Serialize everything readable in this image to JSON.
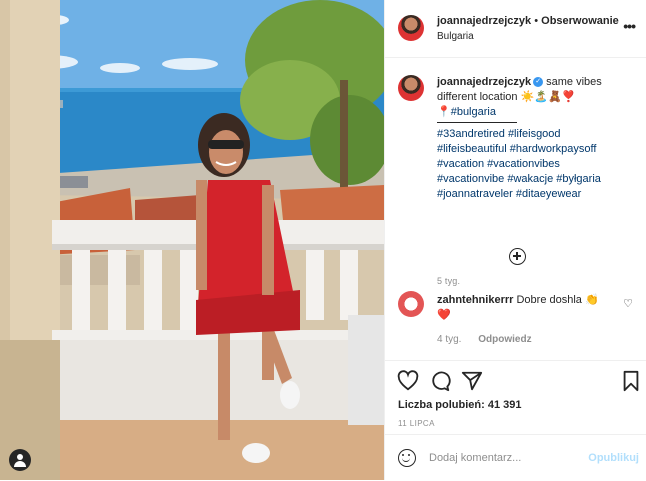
{
  "post": {
    "username": "joannajedrzejczyk",
    "follow_label": "Obserwowanie",
    "location": "Bulgaria",
    "separator_dot": "•",
    "more_icon": "more-horizontal-icon"
  },
  "caption": {
    "username": "joannajedrzejczyk",
    "verified_mark": "✓",
    "line1": "same vibes different location ☀️🏝️🧸❣️",
    "location_pin": "📍",
    "location_tag": "#bulgaria",
    "hashtags": [
      "#33andretired #lifeisgood",
      "#lifeisbeautiful #hardworkpaysoff",
      "#vacation #vacationvibes",
      "#vacationvibe #wakacje #byłgaria",
      "#joannatraveler #ditaeyewear"
    ],
    "time": "5 tyg."
  },
  "comment": {
    "username": "zahntehnikerrr",
    "text": "Dobre doshla 👏",
    "heart_emoji": "❤️",
    "time": "4 tyg.",
    "reply_label": "Odpowiedz"
  },
  "actions": {
    "likes_label": "Liczba polubień:",
    "likes_count": "41 391",
    "date": "11 LIPCA"
  },
  "add_comment": {
    "placeholder": "Dodaj komentarz...",
    "post_label": "Opublikuj"
  },
  "colors": {
    "accent": "#3897f0",
    "post_disabled": "#b2dffc",
    "muted": "#8e8e8e"
  }
}
